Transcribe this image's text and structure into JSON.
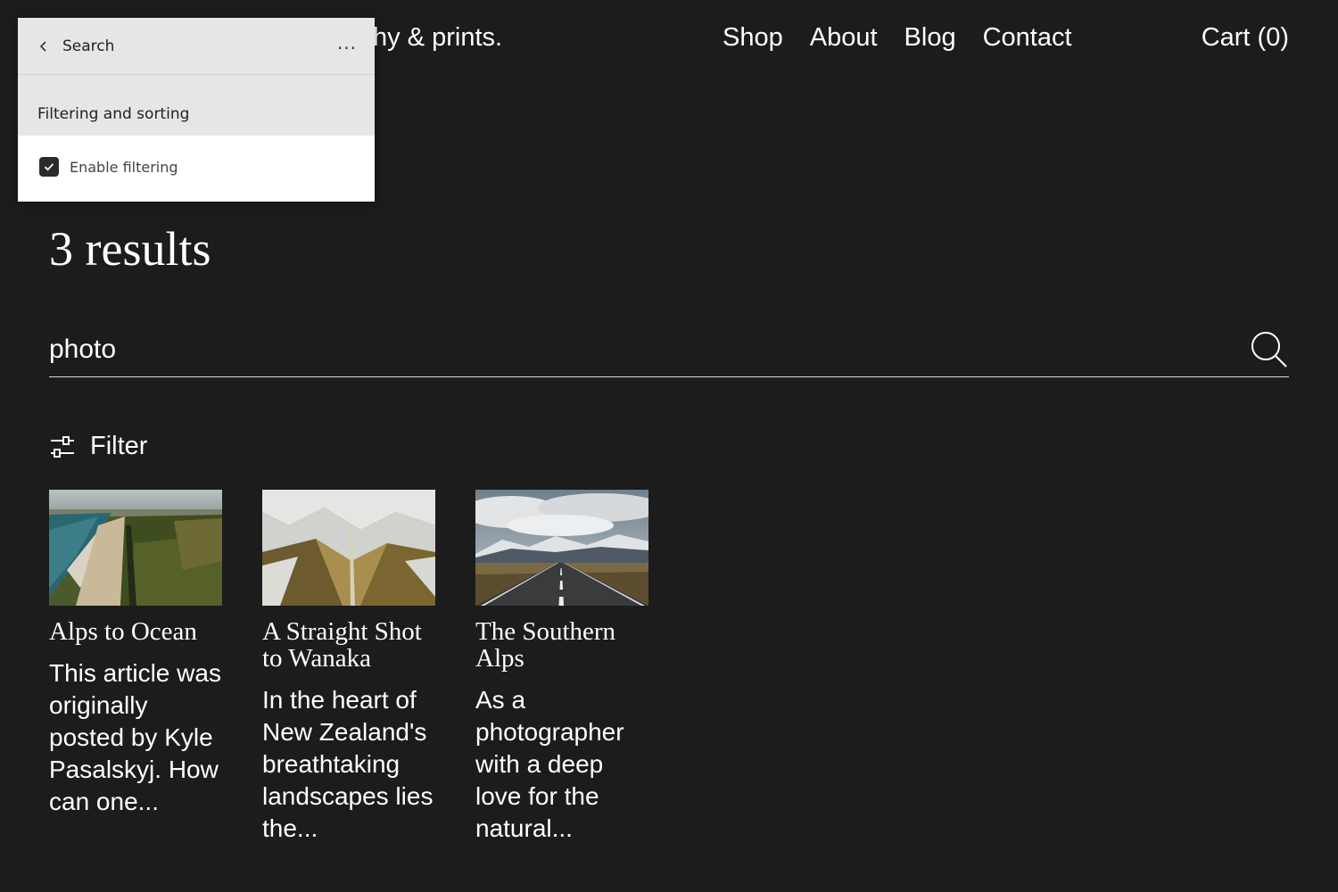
{
  "header": {
    "tagline": "hy & prints.",
    "nav": [
      "Shop",
      "About",
      "Blog",
      "Contact"
    ],
    "cart": "Cart (0)"
  },
  "editor_panel": {
    "back_label": "Search",
    "more_label": "...",
    "section_title": "Filtering and sorting",
    "option_label": "Enable filtering",
    "option_checked": true
  },
  "results": {
    "title": "3 results",
    "query": "photo",
    "filter_label": "Filter",
    "items": [
      {
        "title": "Alps to Ocean",
        "excerpt": "This article was originally posted  by Kyle Pasalskyj. How can one..."
      },
      {
        "title": "A Straight Shot to Wanaka",
        "excerpt": "In the heart of New Zealand's breathtaking landscapes lies the..."
      },
      {
        "title": "The Southern Alps",
        "excerpt": "As a photographer with a deep love for the natural..."
      }
    ]
  },
  "colors": {
    "background": "#1c1c1c",
    "text": "#ffffff",
    "panel_header": "#e6e6e6"
  }
}
